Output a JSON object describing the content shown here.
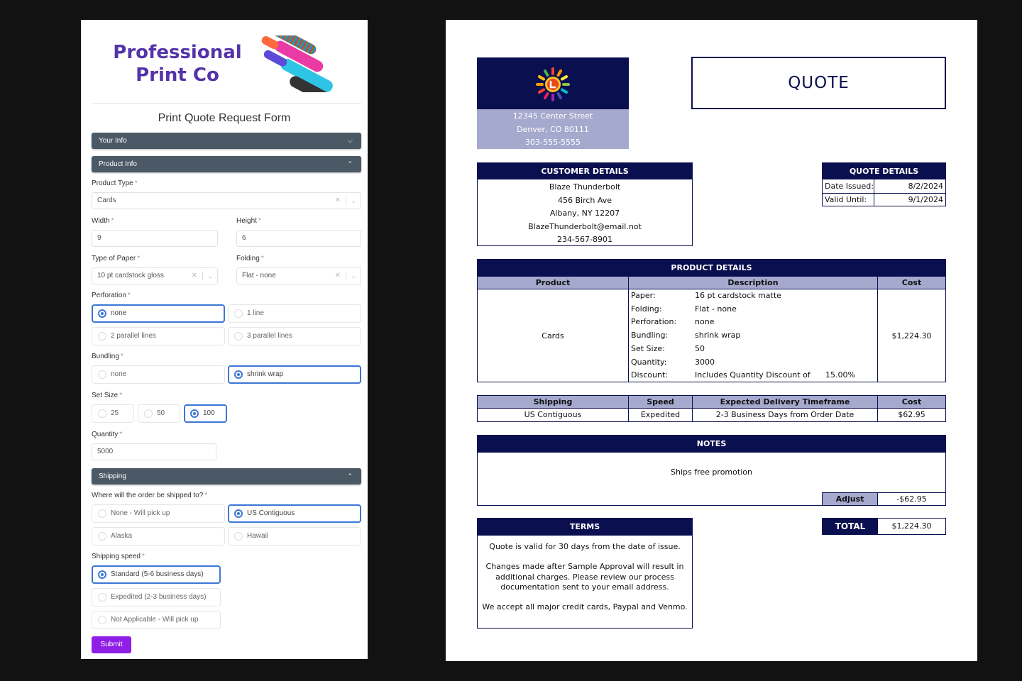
{
  "form": {
    "logo": {
      "line1": "Professional",
      "line2": "Print Co"
    },
    "title": "Print Quote Request Form",
    "sections": {
      "your_info": "Your Info",
      "product_info": "Product Info",
      "shipping": "Shipping"
    },
    "product_type": {
      "label": "Product Type",
      "value": "Cards"
    },
    "width": {
      "label": "Width",
      "value": "9"
    },
    "height": {
      "label": "Height",
      "value": "6"
    },
    "paper": {
      "label": "Type of Paper",
      "value": "10 pt cardstock gloss"
    },
    "folding": {
      "label": "Folding",
      "value": "Flat - none"
    },
    "perforation": {
      "label": "Perforation",
      "options": [
        "none",
        "1 line",
        "2 parallel lines",
        "3 parallel lines"
      ],
      "selected": "none"
    },
    "bundling": {
      "label": "Bundling",
      "options": [
        "none",
        "shrink wrap"
      ],
      "selected": "shrink wrap"
    },
    "set_size": {
      "label": "Set Size",
      "options": [
        "25",
        "50",
        "100"
      ],
      "selected": "100"
    },
    "quantity": {
      "label": "Quantity",
      "value": "5000"
    },
    "ship_to": {
      "label": "Where will the order be shipped to?",
      "options": [
        "None - Will pick up",
        "US Contiguous",
        "Alaska",
        "Hawaii"
      ],
      "selected": "US Contiguous"
    },
    "ship_speed": {
      "label": "Shipping speed",
      "options": [
        "Standard (5-6 business days)",
        "Expedited (2-3 business days)",
        "Not Applicable - Will pick up"
      ],
      "selected": "Standard (5-6 business days)"
    },
    "required_mark": "*",
    "submit_label": "Submit"
  },
  "quote": {
    "title": "QUOTE",
    "company": {
      "street": "12345 Center Street",
      "city": "Denver, CO 80111",
      "phone": "303-555-5555"
    },
    "customer": {
      "header": "CUSTOMER DETAILS",
      "name": "Blaze Thunderbolt",
      "street": "456 Birch Ave",
      "city": "Albany, NY 12207",
      "email": "BlazeThunderbolt@email.not",
      "phone": "234-567-8901"
    },
    "details": {
      "header": "QUOTE DETAILS",
      "issued_label": "Date Issued:",
      "issued": "8/2/2024",
      "valid_label": "Valid Until:",
      "valid": "9/1/2024"
    },
    "product": {
      "header": "PRODUCT DETAILS",
      "col_product": "Product",
      "col_description": "Description",
      "col_cost": "Cost",
      "name": "Cards",
      "rows": [
        {
          "k": "Paper:",
          "v": "16 pt cardstock matte"
        },
        {
          "k": "Folding:",
          "v": "Flat - none"
        },
        {
          "k": "Perforation:",
          "v": "none"
        },
        {
          "k": "Bundling:",
          "v": "shrink wrap"
        },
        {
          "k": "Set Size:",
          "v": "50"
        },
        {
          "k": "Quantity:",
          "v": "3000"
        },
        {
          "k": "Discount:",
          "v": "Includes Quantity Discount of",
          "extra": "15.00%"
        }
      ],
      "cost": "$1,224.30"
    },
    "shipping": {
      "col_shipping": "Shipping",
      "col_speed": "Speed",
      "col_timeframe": "Expected Delivery Timeframe",
      "col_cost": "Cost",
      "shipping": "US Contiguous",
      "speed": "Expedited",
      "timeframe": "2-3 Business Days from Order Date",
      "cost": "$62.95"
    },
    "notes": {
      "header": "NOTES",
      "text": "Ships free promotion",
      "adjust_label": "Adjust",
      "adjust": "-$62.95"
    },
    "terms": {
      "header": "TERMS",
      "p1": "Quote is valid for 30 days from the date of issue.",
      "p2": "Changes made after Sample Approval will result in additional charges. Please review our process documentation sent to your email address.",
      "p3": "We accept all major credit cards, Paypal and Venmo."
    },
    "total": {
      "label": "TOTAL",
      "value": "$1,224.30"
    }
  }
}
